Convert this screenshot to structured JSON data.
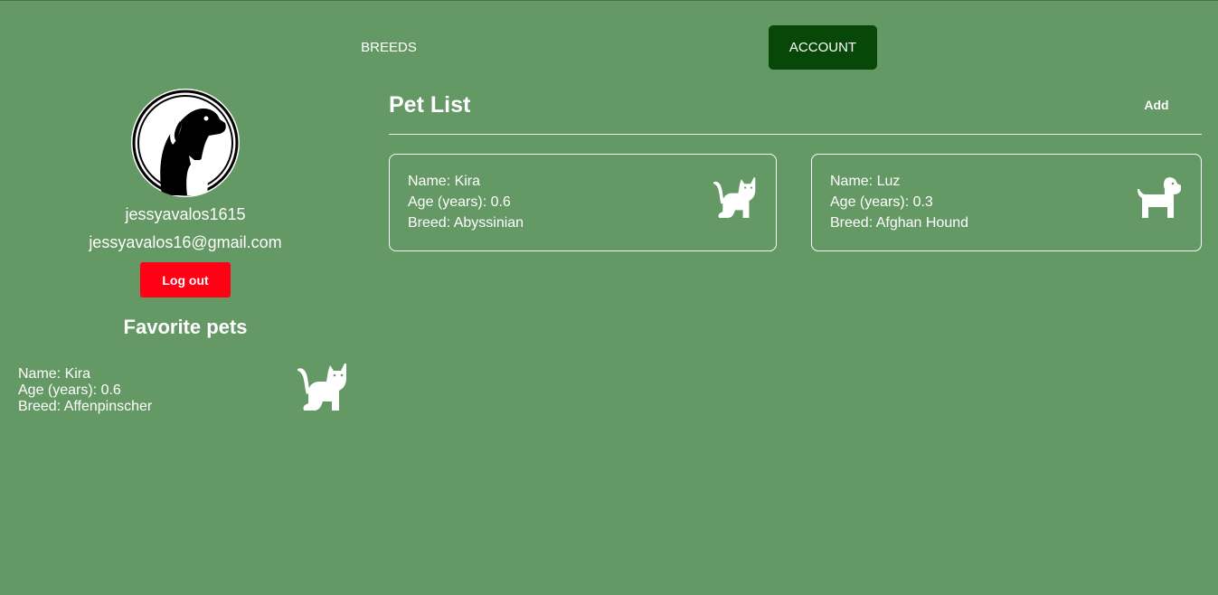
{
  "nav": {
    "breeds": "BREEDS",
    "account": "ACCOUNT"
  },
  "profile": {
    "avatar_icon": "dog-and-cat-logo-icon",
    "username": "jessyavalos1615",
    "email": "jessyavalos16@gmail.com",
    "logout_label": "Log out"
  },
  "favorites": {
    "title": "Favorite pets",
    "items": [
      {
        "name": "Name: Kira",
        "age": "Age (years): 0.6",
        "breed": "Breed: Affenpinscher",
        "icon": "cat-icon"
      }
    ]
  },
  "pet_list": {
    "title": "Pet List",
    "add_label": "Add",
    "items": [
      {
        "name": "Name: Kira",
        "age": "Age (years): 0.6",
        "breed": "Breed: Abyssinian",
        "icon": "cat-icon"
      },
      {
        "name": "Name: Luz",
        "age": "Age (years): 0.3",
        "breed": "Breed: Afghan Hound",
        "icon": "dog-icon"
      }
    ]
  },
  "colors": {
    "background": "#649864",
    "account_button": "#074707",
    "logout_button": "#ff0015",
    "text": "#ffffff"
  }
}
